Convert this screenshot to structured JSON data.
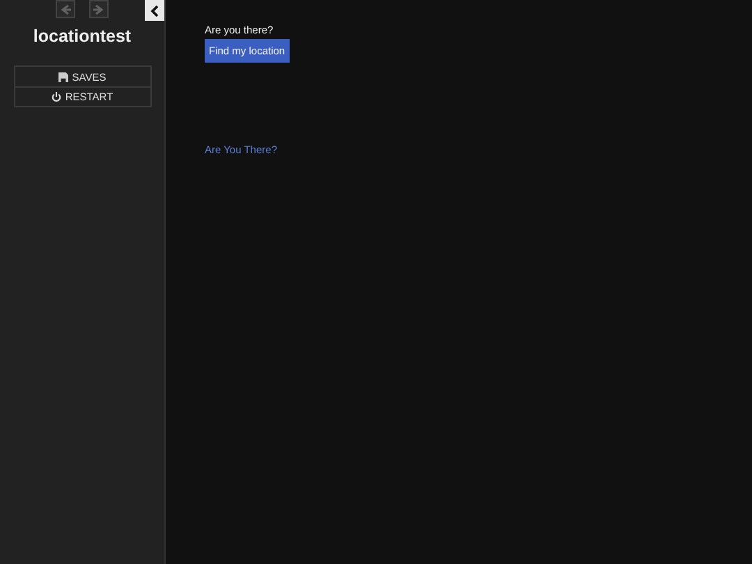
{
  "sidebar": {
    "nav_buttons": [
      {
        "kind": "back",
        "disabled": true
      },
      {
        "kind": "forward",
        "disabled": true
      }
    ],
    "title": "locationtest",
    "menu": [
      {
        "kind": "saves",
        "label": "SAVES"
      },
      {
        "kind": "restart",
        "label": "RESTART"
      }
    ]
  },
  "main": {
    "prompt": "Are you there?",
    "button": "Find my location",
    "link": "Are You There?"
  }
}
